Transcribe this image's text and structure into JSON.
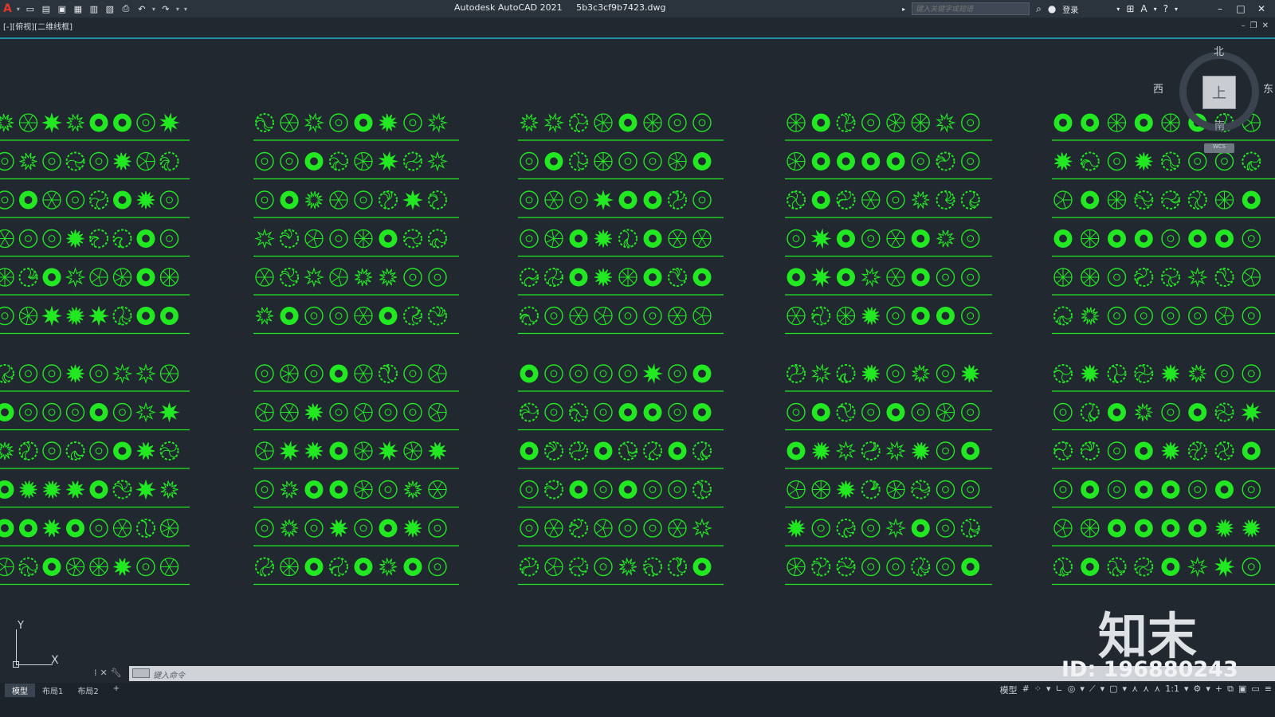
{
  "app": {
    "title": "Autodesk AutoCAD 2021",
    "file": "5b3c3cf9b7423.dwg",
    "logo": "A"
  },
  "quick_access": [
    "new-icon",
    "open-icon",
    "save-icon",
    "saveas-icon",
    "plot-preview-icon",
    "publish-icon",
    "print-icon",
    "undo-icon",
    "redo-icon"
  ],
  "search": {
    "placeholder": "键入关键字或短语"
  },
  "account": {
    "login_label": "登录"
  },
  "viewport": {
    "label": "[-][俯视][二维线框]"
  },
  "viewcube": {
    "north": "北",
    "west": "西",
    "east": "东",
    "south": "南",
    "face": "上",
    "wcs": "WCS"
  },
  "ucs": {
    "x_label": "X",
    "y_label": "Y"
  },
  "command": {
    "placeholder": "键入命令"
  },
  "layout_tabs": [
    {
      "label": "模型",
      "active": true
    },
    {
      "label": "布局1",
      "active": false
    },
    {
      "label": "布局2",
      "active": false
    },
    {
      "label": "+",
      "active": false
    }
  ],
  "status": {
    "model_label": "模型",
    "scale_label": "1:1"
  },
  "watermark": {
    "logo_text": "知末",
    "id_text": "ID: 196880243"
  },
  "colors": {
    "background": "#212830",
    "linework": "#22e822",
    "accent_cyan": "#1a8fa6"
  }
}
